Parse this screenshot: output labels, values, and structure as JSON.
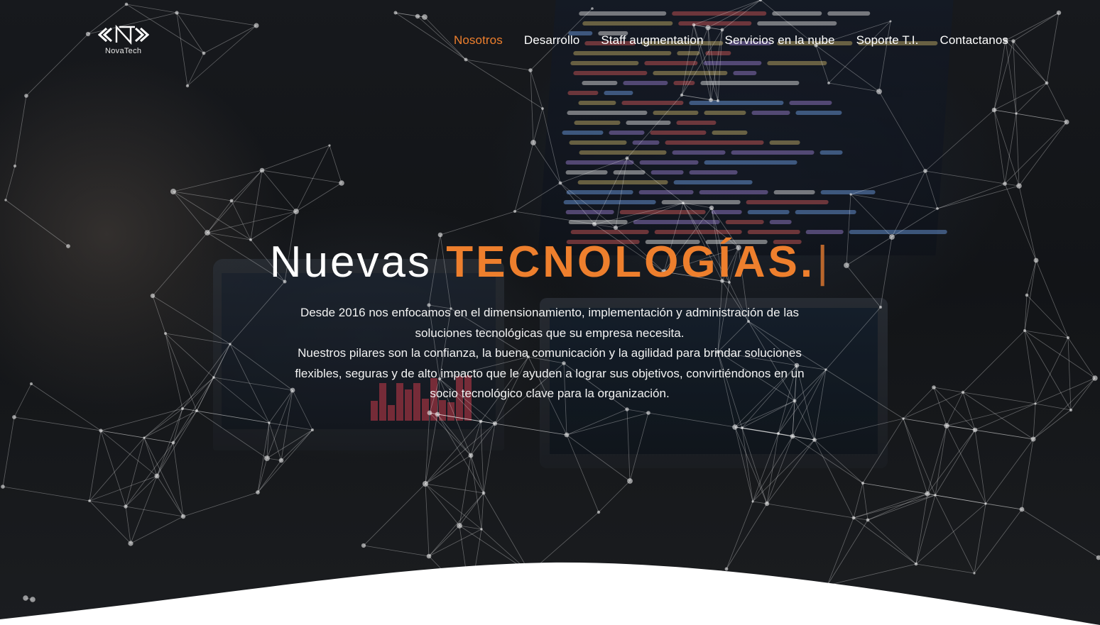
{
  "brand": {
    "logo_mark": "«NT»",
    "logo_text": "NovaTech"
  },
  "nav": {
    "items": [
      {
        "label": "Nosotros",
        "active": true
      },
      {
        "label": "Desarrollo",
        "active": false
      },
      {
        "label": "Staff augmentation",
        "active": false
      },
      {
        "label": "Servicios en la nube",
        "active": false
      },
      {
        "label": "Soporte T.I.",
        "active": false
      },
      {
        "label": "Contactanos",
        "active": false
      }
    ]
  },
  "hero": {
    "headline_light": "Nuevas",
    "headline_strong": "TECNOLOGÍAS.",
    "cursor": "|",
    "paragraph_1": "Desde 2016 nos enfocamos en el dimensionamiento, implementación y administración de las soluciones tecnológicas que su empresa necesita.",
    "paragraph_2": "Nuestros pilares son la confianza, la buena comunicación y la agilidad para brindar soluciones flexibles, seguras y de alto impacto que le ayuden a lograr sus objetivos, convirtiéndonos en un socio tecnológico clave para la organización."
  },
  "colors": {
    "accent": "#ee7f2d",
    "text": "#ffffff",
    "background": "#121417"
  }
}
